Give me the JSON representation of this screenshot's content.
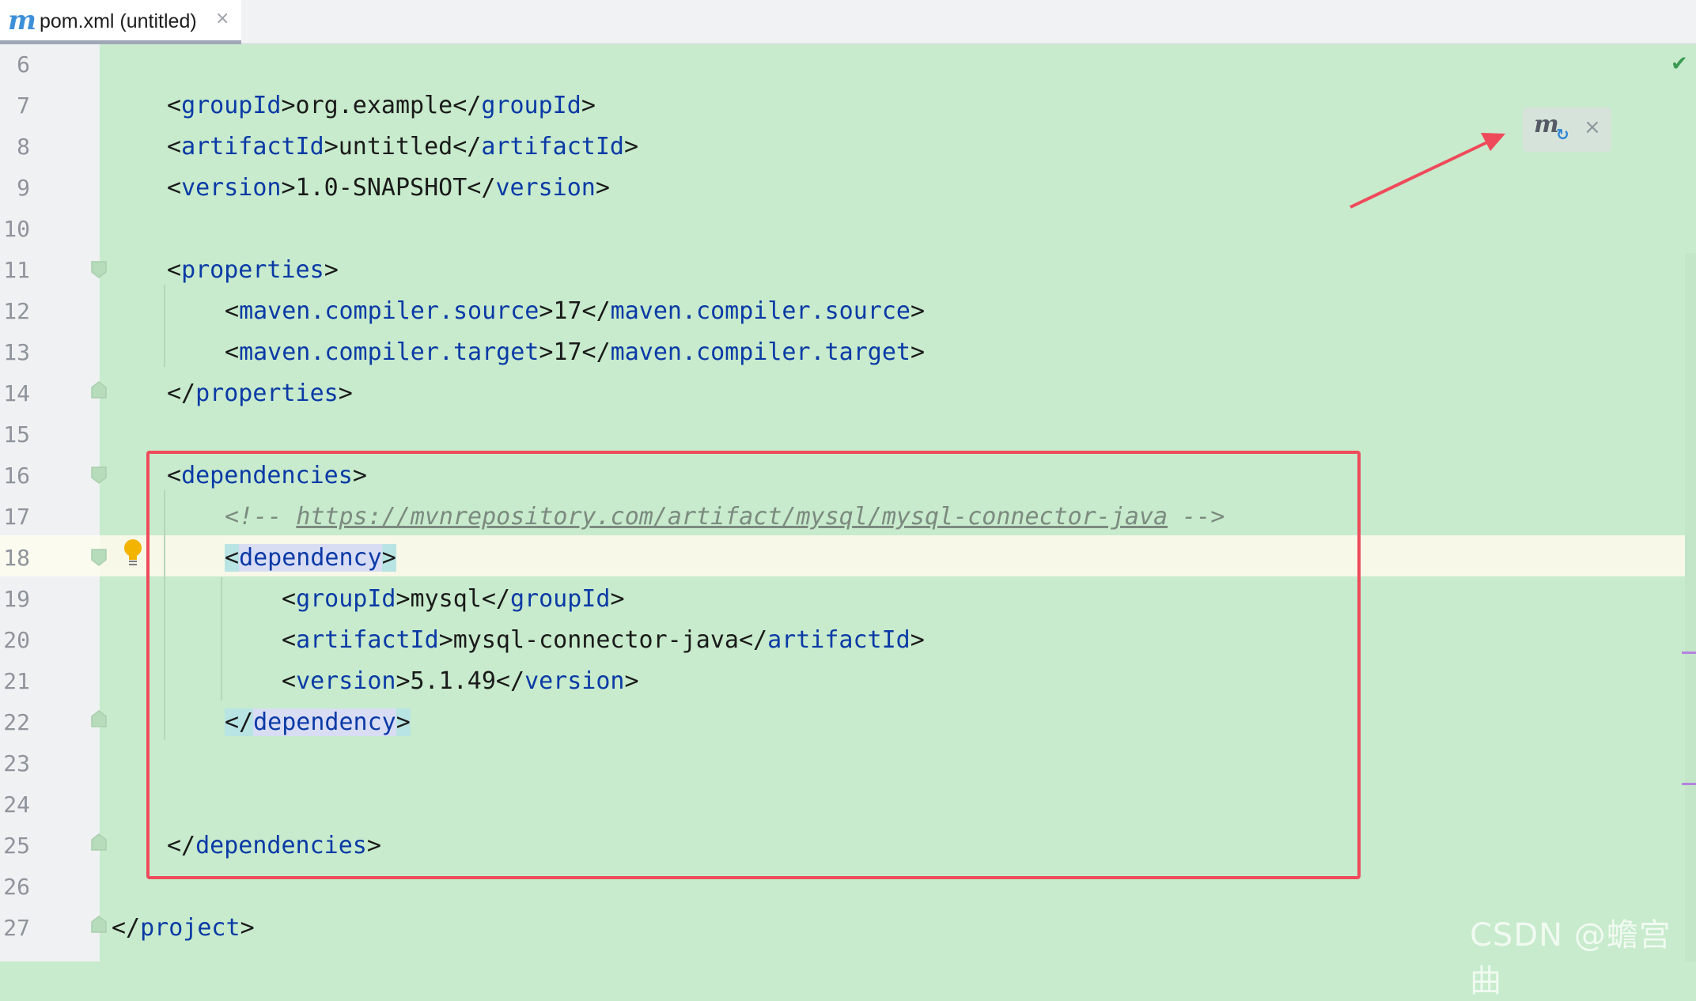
{
  "tab": {
    "icon": "maven-m-icon",
    "title": "pom.xml (untitled)",
    "close_glyph": "×"
  },
  "editor": {
    "lines": [
      {
        "num": "6",
        "text": ""
      },
      {
        "num": "7",
        "text": "<groupId>org.example</groupId>"
      },
      {
        "num": "8",
        "text": "<artifactId>untitled</artifactId>"
      },
      {
        "num": "9",
        "text": "<version>1.0-SNAPSHOT</version>"
      },
      {
        "num": "10",
        "text": ""
      },
      {
        "num": "11",
        "text": "<properties>"
      },
      {
        "num": "12",
        "text": "<maven.compiler.source>17</maven.compiler.source>"
      },
      {
        "num": "13",
        "text": "<maven.compiler.target>17</maven.compiler.target>"
      },
      {
        "num": "14",
        "text": "</properties>"
      },
      {
        "num": "15",
        "text": ""
      },
      {
        "num": "16",
        "text": "<dependencies>"
      },
      {
        "num": "17",
        "text": "<!-- https://mvnrepository.com/artifact/mysql/mysql-connector-java -->"
      },
      {
        "num": "18",
        "text": "<dependency>"
      },
      {
        "num": "19",
        "text": "<groupId>mysql</groupId>"
      },
      {
        "num": "20",
        "text": "<artifactId>mysql-connector-java</artifactId>"
      },
      {
        "num": "21",
        "text": "<version>5.1.49</version>"
      },
      {
        "num": "22",
        "text": "</dependency>"
      },
      {
        "num": "23",
        "text": ""
      },
      {
        "num": "24",
        "text": ""
      },
      {
        "num": "25",
        "text": "</dependencies>"
      },
      {
        "num": "26",
        "text": ""
      },
      {
        "num": "27",
        "text": "</project>"
      }
    ],
    "comment_open": "<!-- ",
    "comment_url": "https://mvnrepository.com/artifact/mysql/mysql-connector-java",
    "comment_close": " -->"
  },
  "maven_popup": {
    "icon": "maven-m-icon",
    "refresh_icon": "reload-icon",
    "close_glyph": "×"
  },
  "status": {
    "check_glyph": "✔"
  },
  "watermark": "CSDN @蟾宫曲",
  "colors": {
    "editor_bg": "#c7ebcc",
    "tag": "#0b3aa6",
    "annotation_red": "#ef4a5b",
    "current_line": "#f7f8e8"
  }
}
